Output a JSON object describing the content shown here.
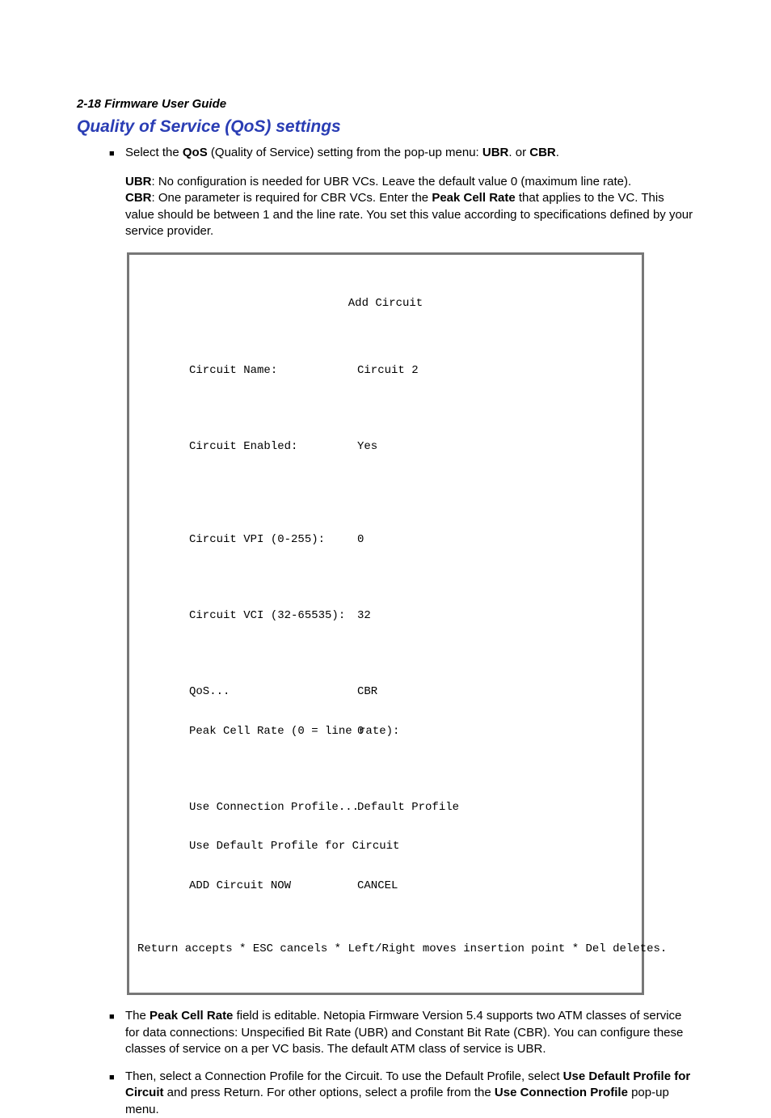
{
  "header": "2-18  Firmware User Guide",
  "heading": "Quality of Service (QoS) settings",
  "bullet1": {
    "pre": "Select the ",
    "b1": "QoS",
    "mid1": " (Quality of Service) setting from the pop-up menu: ",
    "b2": "UBR",
    "mid2": ". or ",
    "b3": "CBR",
    "post": "."
  },
  "sub1": {
    "b1": "UBR",
    "t1": ": No configuration is needed for UBR VCs. Leave the default value 0 (maximum line rate).",
    "b2": "CBR",
    "t2": ": One parameter is required for CBR VCs. Enter the ",
    "b3": "Peak Cell Rate",
    "t3": " that applies to the VC. This value should be between 1 and the line rate. You set this value according to specifications defined by your service provider."
  },
  "terminal": {
    "title": "Add Circuit",
    "rows": {
      "r0l": "Circuit Name:",
      "r0v": "Circuit 2",
      "r1l": "Circuit Enabled:",
      "r1v": "Yes",
      "r2l": "Circuit VPI (0-255):",
      "r2v": "0",
      "r3l": "Circuit VCI (32-65535):",
      "r3v": "32",
      "r4l": "QoS...",
      "r4v": "CBR",
      "r5l": "Peak Cell Rate (0 = line rate):",
      "r5v": "0",
      "r6l": "Use Connection Profile...",
      "r6v": "Default Profile",
      "r7l": "Use Default Profile for Circuit",
      "r7v": "",
      "r8l": "ADD Circuit NOW",
      "r8v": "CANCEL"
    },
    "footer": "Return accepts * ESC cancels * Left/Right moves insertion point * Del deletes."
  },
  "bullet2": {
    "pre": "The ",
    "b1": "Peak Cell Rate",
    "post": " field is editable. Netopia Firmware Version 5.4 supports two ATM classes of service for data connections: Unspecified Bit Rate (UBR) and Constant Bit Rate (CBR). You can configure these classes of service on a per VC basis. The default ATM class of service is UBR."
  },
  "bullet3": {
    "t1": "Then, select a Connection Profile for the Circuit. To use the Default Profile, select ",
    "b1": "Use Default Profile for Circuit",
    "t2": " and press Return. For other options, select a profile from the ",
    "b2": "Use Connection Profile",
    "t3": " pop-up menu."
  }
}
